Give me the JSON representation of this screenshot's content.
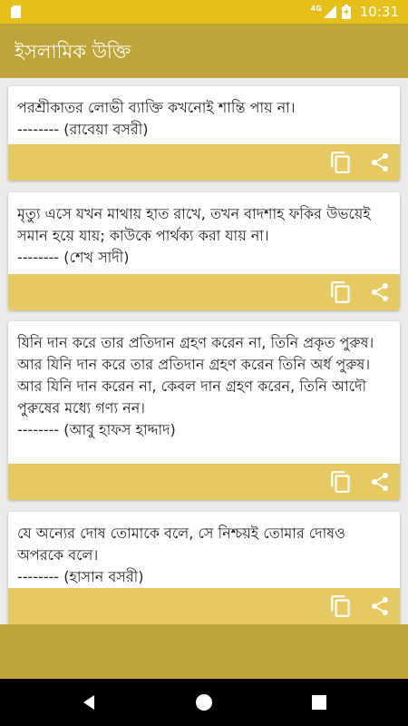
{
  "status_bar": {
    "time": "10:31",
    "network": "4G",
    "icons": [
      "sd-card-icon",
      "signal-icon",
      "battery-charging-icon"
    ]
  },
  "app_bar": {
    "title": "ইসলামিক উক্তি"
  },
  "quotes": [
    {
      "text": "পরশ্রীকাতর লোভী ব্যাক্তি কখনোই শান্তি পায় না।",
      "author": "-------- (রাবেয়া বসরী)"
    },
    {
      "text": "মৃত্যু এসে যখন মাথায় হাত রাখে, তখন বাদশাহ ফকির উভয়েই সমান হয়ে যায়; কাউকে পার্থক্য করা যায় না।",
      "author": "-------- (শেখ সাদী)"
    },
    {
      "text": "যিনি দান করে তার প্রতিদান গ্রহণ করেন না, তিনি প্রকৃত পুরুষ। আর যিনি দান করে তার প্রতিদান গ্রহণ করেন তিনি অর্ধ পুরুষ। আর যিনি দান করেন না, কেবল দান গ্রহণ করেন, তিনি আদৌ পুরুষের মধ্যে গণ্য নন।",
      "author": "-------- (আবু হাফস হাদ্দাদ)"
    },
    {
      "text": "যে অন্যের দোষ তোমাকে বলে, সে নিশ্চয়ই তোমার দোষও অপরকে বলে।",
      "author": "-------- (হাসান বসরী)"
    }
  ],
  "colors": {
    "status_bar": "#e6c01a",
    "app_bar": "#bfa43a",
    "card_actions": "#e6c962",
    "icon": "#ffffff"
  },
  "nav_icons": [
    "back-icon",
    "home-icon",
    "recents-icon"
  ]
}
